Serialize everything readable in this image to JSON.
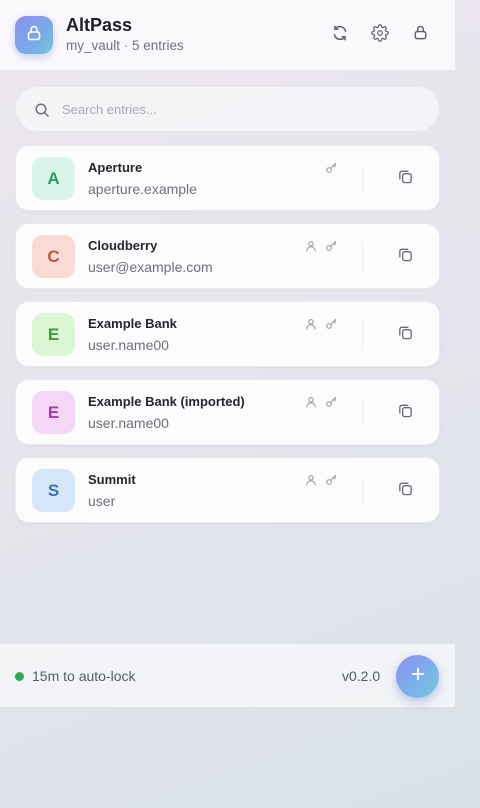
{
  "header": {
    "title": "AltPass",
    "subtitle": "my_vault · 5 entries",
    "logo_icon": "lock-icon",
    "buttons": [
      {
        "name": "sync",
        "icon": "refresh-icon"
      },
      {
        "name": "settings",
        "icon": "gear-icon"
      },
      {
        "name": "lock",
        "icon": "lock-icon"
      }
    ]
  },
  "search": {
    "placeholder": "Search entries...",
    "value": ""
  },
  "entries": [
    {
      "letter": "A",
      "name": "Aperture",
      "username": "aperture.example",
      "has_user": false,
      "has_password": true,
      "avatar_bg": "#d9f5ea",
      "avatar_fg": "#2c9a6a"
    },
    {
      "letter": "C",
      "name": "Cloudberry",
      "username": "user@example.com",
      "has_user": true,
      "has_password": true,
      "avatar_bg": "#f9dbd3",
      "avatar_fg": "#c4543c"
    },
    {
      "letter": "E",
      "name": "Example Bank",
      "username": "user.name00",
      "has_user": true,
      "has_password": true,
      "avatar_bg": "#daf6d4",
      "avatar_fg": "#3a9a3a"
    },
    {
      "letter": "E",
      "name": "Example Bank (imported)",
      "username": "user.name00",
      "has_user": true,
      "has_password": true,
      "avatar_bg": "#f4d7f6",
      "avatar_fg": "#a03ab0"
    },
    {
      "letter": "S",
      "name": "Summit",
      "username": "user",
      "has_user": true,
      "has_password": true,
      "avatar_bg": "#d6e6f9",
      "avatar_fg": "#3a6fb4"
    }
  ],
  "footer": {
    "status_text": "15m to auto-lock",
    "status_color": "#2eaa55",
    "version": "v0.2.0",
    "add_icon": "plus-icon"
  },
  "colors": {
    "accent_start": "#8b8ff0",
    "accent_end": "#72c6d8"
  }
}
